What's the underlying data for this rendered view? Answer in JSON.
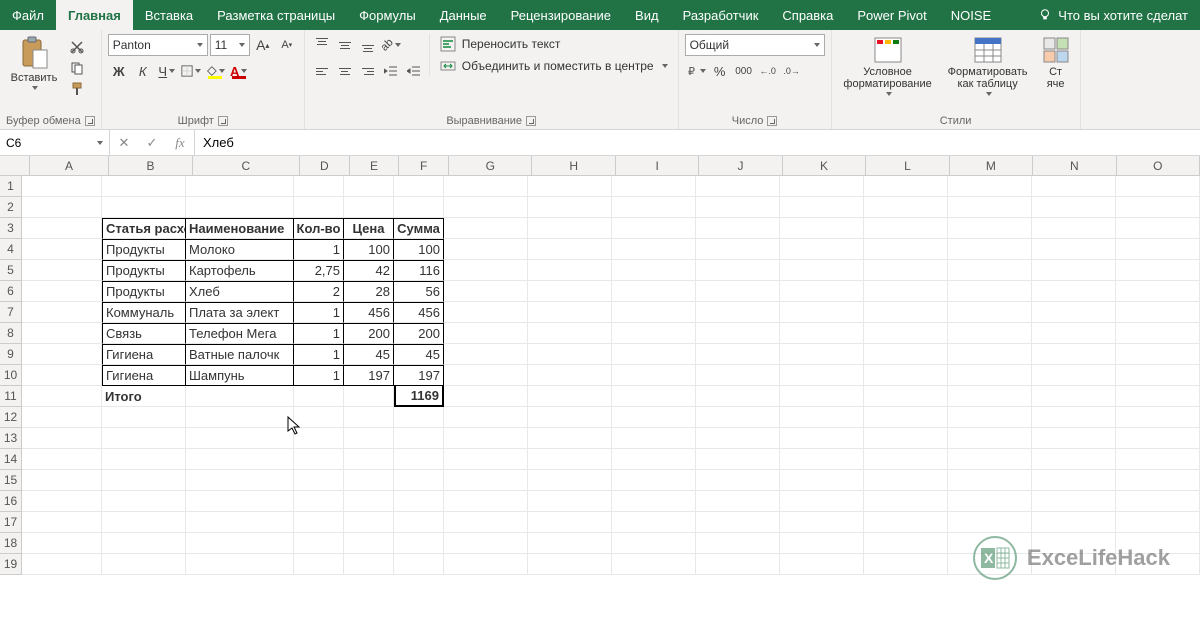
{
  "tabs": {
    "file": "Файл",
    "home": "Главная",
    "insert": "Вставка",
    "layout": "Разметка страницы",
    "formulas": "Формулы",
    "data": "Данные",
    "review": "Рецензирование",
    "view": "Вид",
    "developer": "Разработчик",
    "help": "Справка",
    "powerpivot": "Power Pivot",
    "noise": "NOISE",
    "tellme": "Что вы хотите сделат"
  },
  "ribbon": {
    "clipboard": {
      "paste": "Вставить",
      "label": "Буфер обмена"
    },
    "font": {
      "name": "Panton",
      "size": "11",
      "label": "Шрифт",
      "bold": "Ж",
      "italic": "К",
      "underline": "Ч"
    },
    "alignment": {
      "label": "Выравнивание",
      "wrap": "Переносить текст",
      "merge": "Объединить и поместить в центре"
    },
    "number": {
      "label": "Число",
      "format": "Общий"
    },
    "styles": {
      "label": "Стили",
      "cond": "Условное форматирование",
      "table": "Форматировать как таблицу",
      "cell": "Ст яче"
    }
  },
  "formula_bar": {
    "cell_ref": "C6",
    "formula": "Хлеб"
  },
  "columns": [
    "A",
    "B",
    "C",
    "D",
    "E",
    "F",
    "G",
    "H",
    "I",
    "J",
    "K",
    "L",
    "M",
    "N",
    "O"
  ],
  "rows": [
    "1",
    "2",
    "3",
    "4",
    "5",
    "6",
    "7",
    "8",
    "9",
    "10",
    "11",
    "12",
    "13",
    "14",
    "15",
    "16",
    "17",
    "18",
    "19"
  ],
  "table": {
    "headers": {
      "b": "Статья расход",
      "c": "Наименование",
      "d": "Кол-во",
      "e": "Цена",
      "f": "Сумма"
    },
    "data": [
      {
        "b": "Продукты",
        "c": "Молоко",
        "d": "1",
        "e": "100",
        "f": "100"
      },
      {
        "b": "Продукты",
        "c": "Картофель",
        "d": "2,75",
        "e": "42",
        "f": "116"
      },
      {
        "b": "Продукты",
        "c": "Хлеб",
        "d": "2",
        "e": "28",
        "f": "56"
      },
      {
        "b": "Коммуналь",
        "c": "Плата за элект",
        "d": "1",
        "e": "456",
        "f": "456"
      },
      {
        "b": "Связь",
        "c": "Телефон Мега",
        "d": "1",
        "e": "200",
        "f": "200"
      },
      {
        "b": "Гигиена",
        "c": "Ватные палочк",
        "d": "1",
        "e": "45",
        "f": "45"
      },
      {
        "b": "Гигиена",
        "c": "Шампунь",
        "d": "1",
        "e": "197",
        "f": "197"
      }
    ],
    "footer": {
      "b": "Итого",
      "f": "1169"
    }
  },
  "watermark": "ExceLifeHack"
}
